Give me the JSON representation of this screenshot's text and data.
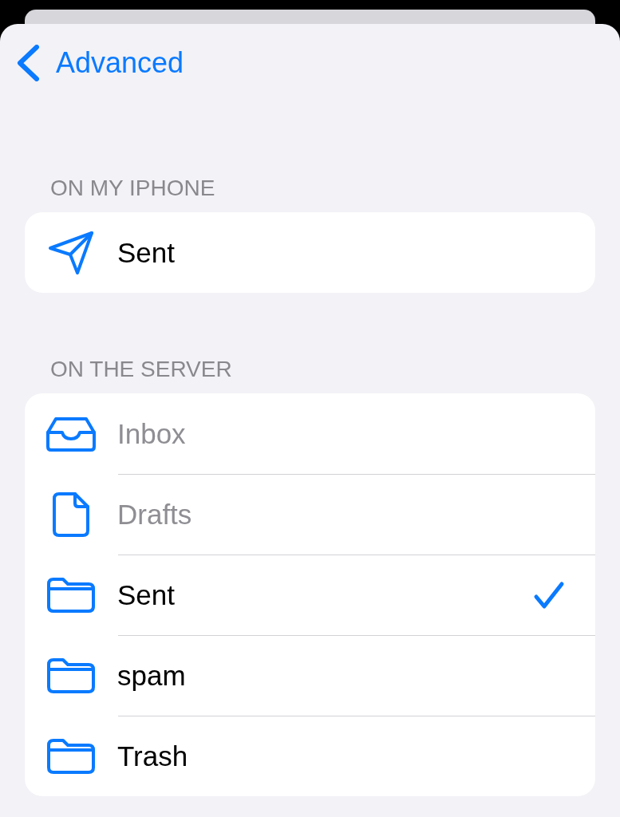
{
  "nav": {
    "back_label": "Advanced"
  },
  "sections": [
    {
      "header": "ON MY IPHONE",
      "rows": [
        {
          "kind": "sent",
          "label": "Sent",
          "disabled": false,
          "selected": false
        }
      ]
    },
    {
      "header": "ON THE SERVER",
      "rows": [
        {
          "kind": "inbox",
          "label": "Inbox",
          "disabled": true,
          "selected": false
        },
        {
          "kind": "drafts",
          "label": "Drafts",
          "disabled": true,
          "selected": false
        },
        {
          "kind": "folder",
          "label": "Sent",
          "disabled": false,
          "selected": true
        },
        {
          "kind": "folder",
          "label": "spam",
          "disabled": false,
          "selected": false
        },
        {
          "kind": "folder",
          "label": "Trash",
          "disabled": false,
          "selected": false
        }
      ]
    }
  ]
}
